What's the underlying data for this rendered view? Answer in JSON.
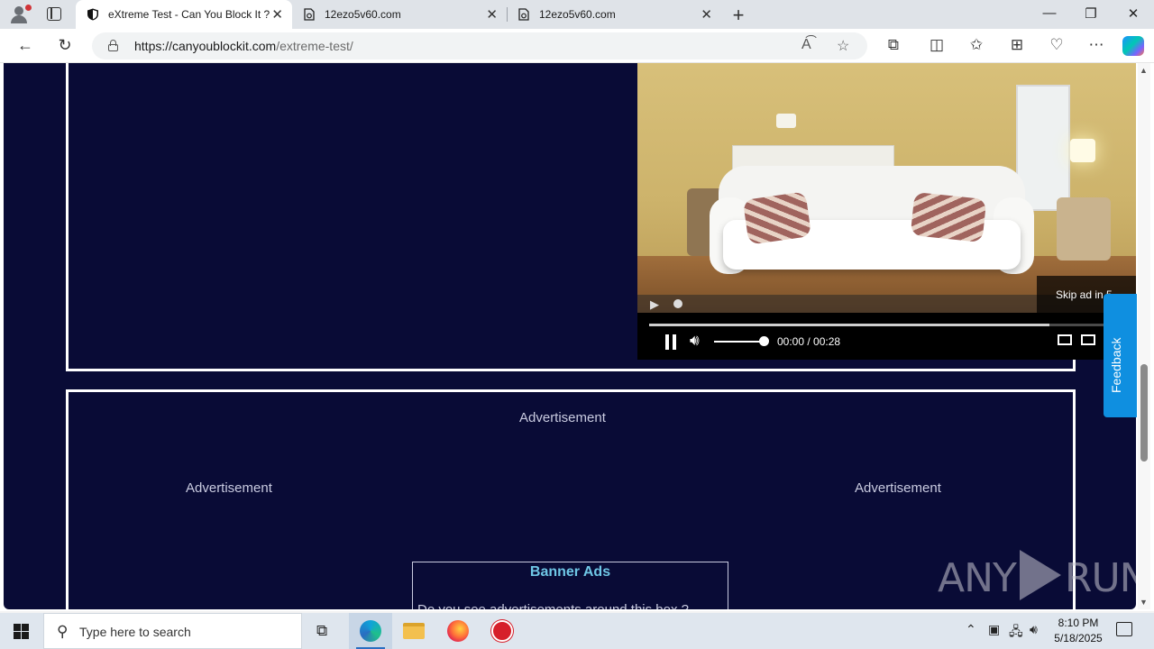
{
  "tabs": [
    {
      "title": "eXtreme Test - Can You Block It ?",
      "active": true
    },
    {
      "title": "12ezo5v60.com",
      "active": false
    },
    {
      "title": "12ezo5v60.com",
      "active": false
    }
  ],
  "address": {
    "host": "https://canyoublockit.com",
    "path": "/extreme-test/"
  },
  "video": {
    "skip_text": "Skip ad in 5",
    "time": "00:00 / 00:28",
    "progress": 0.84,
    "volume": 0.85
  },
  "ads": {
    "top": "Advertisement",
    "left": "Advertisement",
    "right": "Advertisement"
  },
  "banner": {
    "heading": "Banner Ads",
    "text": "Do you see advertisements around this box ?"
  },
  "feedback_label": "Feedback",
  "watermark": {
    "left": "ANY",
    "right": "RUN"
  },
  "taskbar": {
    "search_placeholder": "Type here to search",
    "time": "8:10 PM",
    "date": "5/18/2025"
  }
}
